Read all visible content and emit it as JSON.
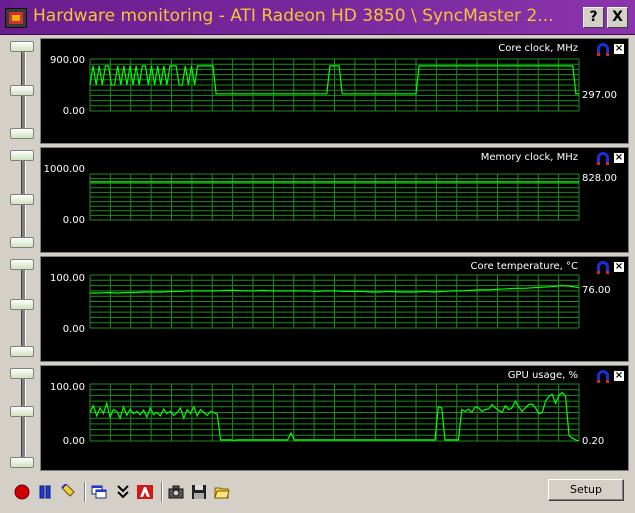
{
  "window": {
    "title": "Hardware monitoring - ATI Radeon HD 3850 \\ SyncMaster 2...",
    "help_label": "?",
    "close_label": "X"
  },
  "colors": {
    "trace": "#00ff00",
    "grid": "#1f8a1f",
    "title_bar": "#7b2aa0",
    "title_text": "#f7c338"
  },
  "panels": [
    {
      "title": "Core clock, MHz",
      "ymax_label": "900.00",
      "ymin_label": "0.00",
      "current_label": "297.00",
      "ymax": 900,
      "ymin": 0
    },
    {
      "title": "Memory clock, MHz",
      "ymax_label": "1000.00",
      "ymin_label": "0.00",
      "current_label": "828.00",
      "ymax": 1000,
      "ymin": 0
    },
    {
      "title": "Core temperature, °C",
      "ymax_label": "100.00",
      "ymin_label": "0.00",
      "current_label": "76.00",
      "ymax": 100,
      "ymin": 0
    },
    {
      "title": "GPU usage, %",
      "ymax_label": "100.00",
      "ymin_label": "0.00",
      "current_label": "0.20",
      "ymax": 100,
      "ymin": 0
    }
  ],
  "toolbar": {
    "icons": [
      "record-icon",
      "pause-icon",
      "clear-icon",
      "windows-icon",
      "collapse-icon",
      "ati-logo-icon",
      "camera-icon",
      "save-icon",
      "open-folder-icon"
    ],
    "setup_label": "Setup"
  },
  "chart_data": [
    {
      "type": "line",
      "title": "Core clock, MHz",
      "ylim": [
        0,
        900
      ],
      "series": [
        {
          "values": [
            450,
            780,
            450,
            780,
            450,
            780,
            780,
            450,
            450,
            780,
            450,
            780,
            450,
            780,
            450,
            780,
            450,
            780,
            780,
            450,
            780,
            450,
            780,
            450,
            780,
            450,
            780,
            780,
            780,
            450,
            450,
            780,
            450,
            780,
            450,
            780,
            780,
            780,
            780,
            780,
            780,
            297,
            297,
            297,
            297,
            297,
            297,
            297,
            297,
            297,
            297,
            297,
            297,
            297,
            297,
            297,
            297,
            297,
            297,
            297,
            297,
            297,
            297,
            297,
            297,
            297,
            297,
            297,
            297,
            297,
            297,
            297,
            297,
            297,
            297,
            297,
            297,
            297,
            780,
            780,
            780,
            780,
            297,
            297,
            297,
            297,
            297,
            297,
            297,
            297,
            297,
            297,
            297,
            297,
            297,
            297,
            297,
            297,
            297,
            297,
            297,
            297,
            297,
            297,
            297,
            297,
            297,
            780,
            780,
            780,
            780,
            780,
            780,
            780,
            780,
            780,
            780,
            780,
            780,
            780,
            780,
            780,
            780,
            780,
            780,
            780,
            780,
            780,
            780,
            780,
            780,
            780,
            780,
            780,
            780,
            780,
            780,
            780,
            780,
            780,
            780,
            780,
            780,
            780,
            780,
            780,
            780,
            780,
            780,
            780,
            780,
            780,
            780,
            780,
            780,
            780,
            780,
            780,
            297,
            297
          ]
        }
      ]
    },
    {
      "type": "line",
      "title": "Memory clock, MHz",
      "ylim": [
        0,
        1000
      ],
      "series": [
        {
          "values": [
            828,
            828,
            828,
            828,
            828,
            828,
            828,
            828,
            828,
            828,
            828,
            828,
            828,
            828,
            828,
            828,
            828,
            828,
            828,
            828,
            828
          ]
        }
      ]
    },
    {
      "type": "line",
      "title": "Core temperature, °C",
      "ylim": [
        0,
        100
      ],
      "series": [
        {
          "values": [
            66,
            66,
            67,
            66,
            67,
            67,
            68,
            68,
            68,
            69,
            69,
            70,
            70,
            70,
            70,
            71,
            71,
            70,
            70,
            71,
            70,
            70,
            70,
            70,
            70,
            69,
            70,
            70,
            69,
            69,
            69,
            68,
            68,
            69,
            68,
            68,
            68,
            69,
            68,
            69,
            70,
            70,
            71,
            72,
            72,
            73,
            74,
            75,
            75,
            76,
            77,
            78,
            80,
            79,
            76
          ]
        }
      ]
    },
    {
      "type": "line",
      "title": "GPU usage, %",
      "ylim": [
        0,
        100
      ],
      "series": [
        {
          "values": [
            50,
            62,
            44,
            58,
            48,
            66,
            42,
            55,
            52,
            40,
            60,
            45,
            56,
            48,
            52,
            46,
            54,
            42,
            58,
            46,
            50,
            44,
            56,
            48,
            52,
            45,
            50,
            58,
            40,
            55,
            48,
            60,
            44,
            55,
            50,
            45,
            52,
            50,
            47,
            2,
            2,
            2,
            2,
            1,
            2,
            2,
            2,
            2,
            2,
            2,
            2,
            2,
            2,
            2,
            2,
            2,
            2,
            2,
            2,
            2,
            14,
            2,
            2,
            2,
            2,
            2,
            2,
            2,
            2,
            2,
            2,
            2,
            2,
            2,
            2,
            2,
            2,
            2,
            2,
            2,
            2,
            2,
            2,
            2,
            2,
            2,
            2,
            2,
            2,
            2,
            2,
            2,
            2,
            2,
            2,
            2,
            2,
            2,
            2,
            2,
            2,
            2,
            2,
            2,
            60,
            58,
            2,
            2,
            2,
            2,
            2,
            55,
            52,
            56,
            50,
            60,
            58,
            52,
            55,
            56,
            64,
            58,
            54,
            50,
            62,
            55,
            58,
            70,
            60,
            52,
            58,
            64,
            65,
            58,
            48,
            50,
            70,
            78,
            82,
            66,
            80,
            85,
            78,
            10,
            5,
            2,
            0.2
          ]
        }
      ]
    }
  ]
}
